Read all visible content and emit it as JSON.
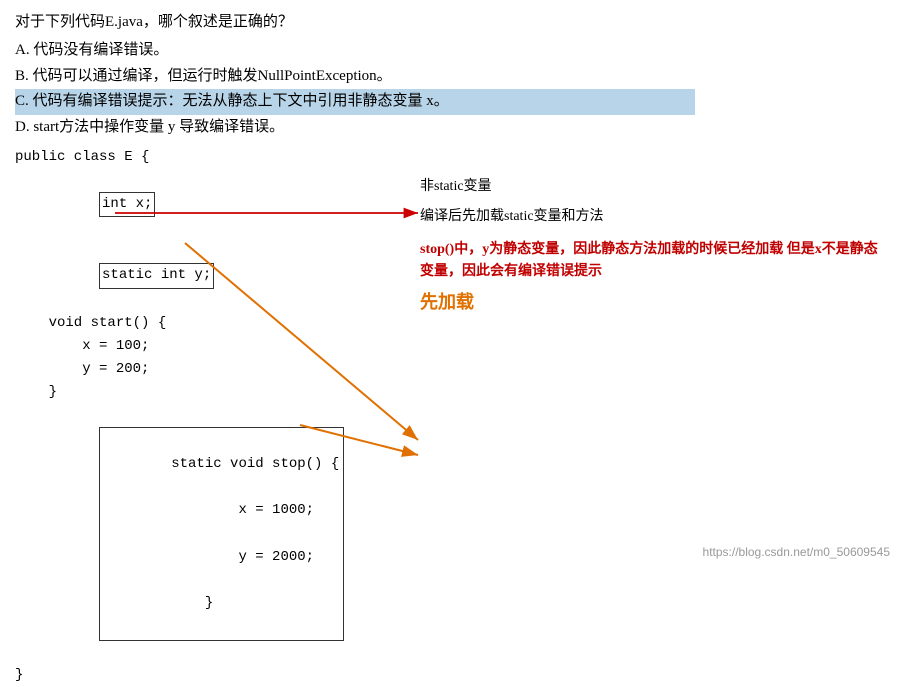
{
  "question": "对于下列代码E.java，哪个叙述是正确的？",
  "options": {
    "A": "A. 代码没有编译错误。",
    "B": "B. 代码可以通过编译，但运行时触发NullPointException。",
    "C": "C. 代码有编译错误提示：无法从静态上下文中引用非静态变量 x。",
    "D": "D. start方法中操作变量 y 导致编译错误。"
  },
  "code": {
    "line1": "public class E {",
    "line2": "    int x;",
    "line3": "    static int y;",
    "line4": "    void start() {",
    "line5": "        x = 100;",
    "line6": "        y = 200;",
    "line7": "    }",
    "line8": "    static void stop() {",
    "line9": "        x = 1000;",
    "line10": "        y = 2000;",
    "line11": "    }",
    "line12": "}"
  },
  "annotations": {
    "label_non_static": "非static变量",
    "label_compile_static": "编译后先加载static变量和方法",
    "label_stop_desc": "stop()中，y为静态变量，因此静态方法加载的时候已经加载\n但是x不是静态变量，因此会有编译错误提示",
    "label_preload": "先加载"
  },
  "watermark": "https://blog.csdn.net/m0_50609545"
}
